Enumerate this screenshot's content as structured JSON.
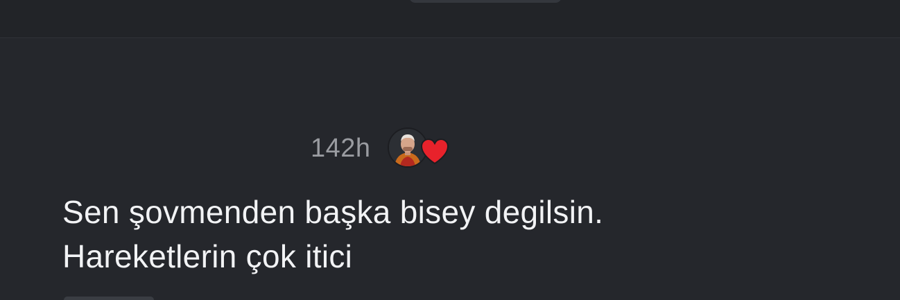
{
  "message": {
    "timestamp": "142h",
    "text_line_1": "Sen şovmenden başka bisey degilsin.",
    "text_line_2": "Hareketlerin çok itici",
    "reaction_icon": "heart-icon"
  },
  "colors": {
    "background": "#25272c",
    "text": "#f2f3f5",
    "timestamp": "#9a9ca1",
    "heart": "#e8222b"
  }
}
